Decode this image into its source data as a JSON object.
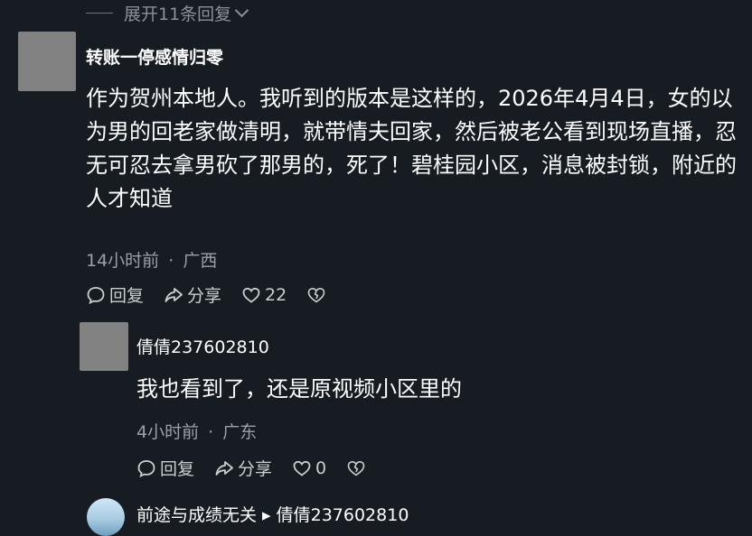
{
  "top_bar": {
    "expand_label": "展开11条回复"
  },
  "comments": [
    {
      "username": "转账一停感情归零",
      "content": "作为贺州本地人。我听到的版本是这样的，2026年4月4日，女的以为男的回老家做清明，就带情夫回家，然后被老公看到现场直播，忍无可忍去拿男砍了那男的，死了！碧桂园小区，消息被封锁，附近的人才知道",
      "time": "14小时前",
      "location": "广西",
      "reply_label": "回复",
      "share_label": "分享",
      "likes": "22"
    },
    {
      "username": "倩倩237602810",
      "content": "我也看到了，还是原视频小区里的",
      "time": "4小时前",
      "location": "广东",
      "reply_label": "回复",
      "share_label": "分享",
      "likes": "0"
    },
    {
      "username": "前途与成绩无关 ▸ 倩倩237602810"
    }
  ],
  "meta_separator": "·",
  "icons": [
    "comment-icon",
    "share-icon",
    "heart-icon",
    "dislike-heart-icon",
    "chevron-down-icon"
  ],
  "colors": {
    "background": "#161c22",
    "text": "#ffffff",
    "meta": "#9aa0a6",
    "avatar_placeholder": "#828282"
  }
}
